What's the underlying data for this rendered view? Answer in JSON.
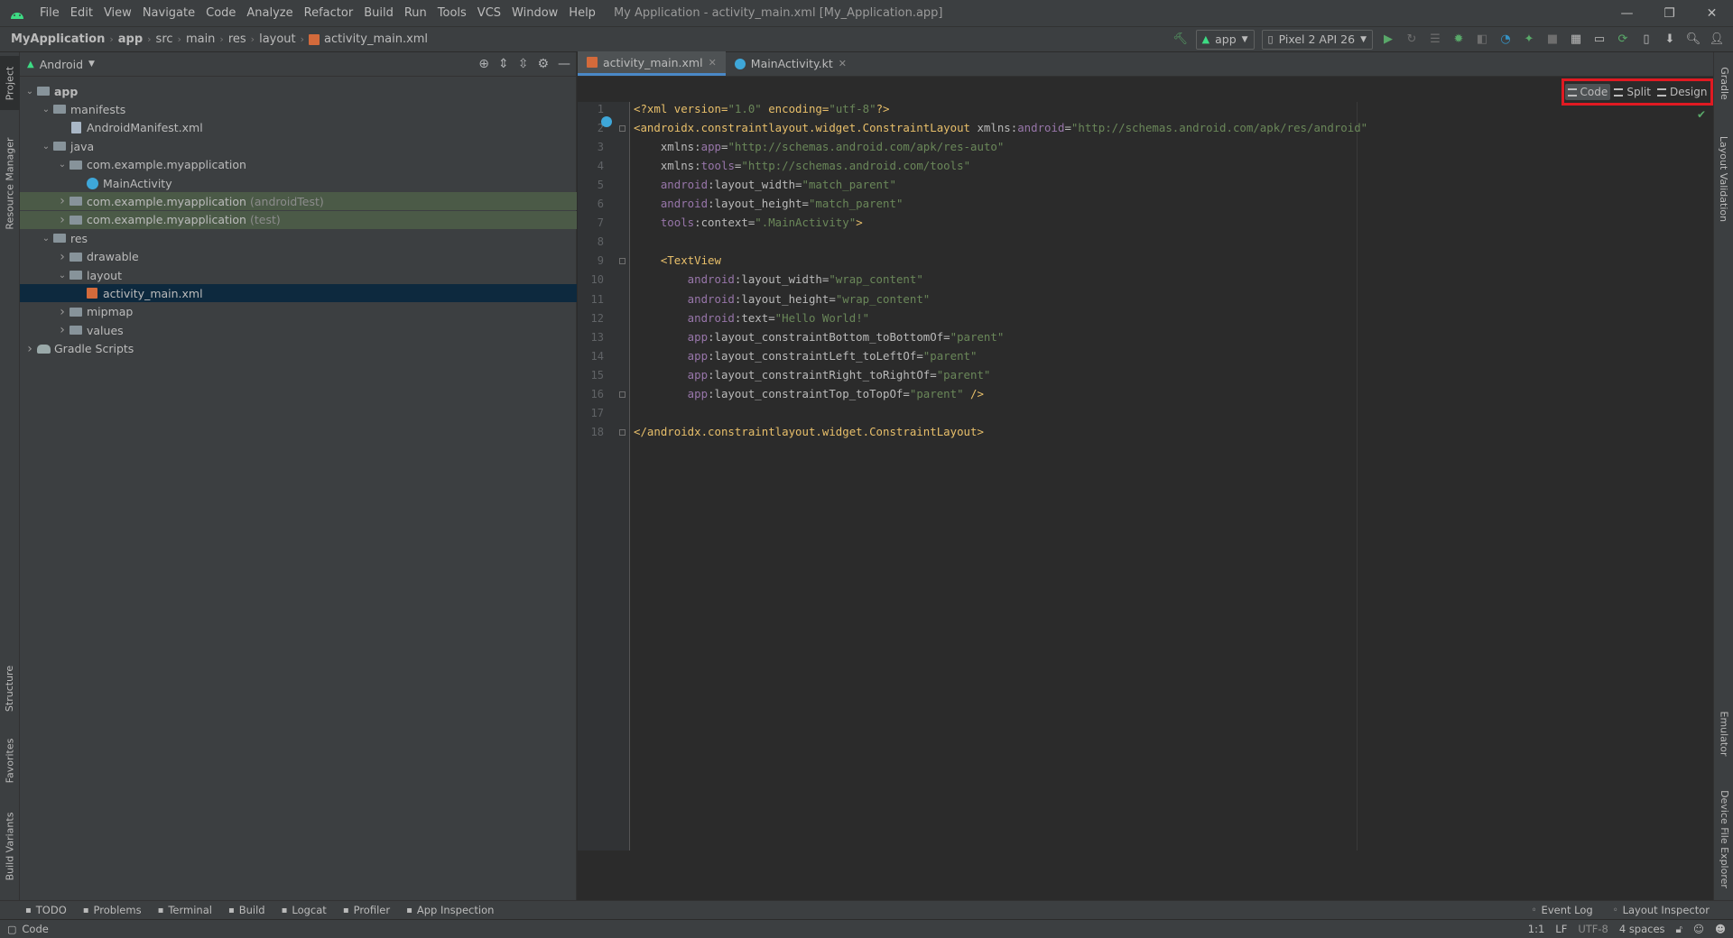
{
  "menu": [
    "File",
    "Edit",
    "View",
    "Navigate",
    "Code",
    "Analyze",
    "Refactor",
    "Build",
    "Run",
    "Tools",
    "VCS",
    "Window",
    "Help"
  ],
  "window_title": "My Application - activity_main.xml [My_Application.app]",
  "breadcrumb": [
    "MyApplication",
    "app",
    "src",
    "main",
    "res",
    "layout",
    "activity_main.xml"
  ],
  "run_config": "app",
  "device": "Pixel 2 API 26",
  "project_panel": {
    "view": "Android"
  },
  "tree": [
    {
      "label": "app",
      "depth": 0,
      "expanded": true,
      "icon": "folder",
      "bold": true
    },
    {
      "label": "manifests",
      "depth": 1,
      "expanded": true,
      "icon": "folder"
    },
    {
      "label": "AndroidManifest.xml",
      "depth": 2,
      "icon": "file"
    },
    {
      "label": "java",
      "depth": 1,
      "expanded": true,
      "icon": "folder"
    },
    {
      "label": "com.example.myapplication",
      "depth": 2,
      "expanded": true,
      "icon": "folder"
    },
    {
      "label": "MainActivity",
      "depth": 3,
      "icon": "kotlin"
    },
    {
      "label": "com.example.myapplication",
      "suffix": "(androidTest)",
      "depth": 2,
      "expanded": false,
      "icon": "folder",
      "state": "highlight"
    },
    {
      "label": "com.example.myapplication",
      "suffix": "(test)",
      "depth": 2,
      "expanded": false,
      "icon": "folder",
      "state": "highlight"
    },
    {
      "label": "res",
      "depth": 1,
      "expanded": true,
      "icon": "folder"
    },
    {
      "label": "drawable",
      "depth": 2,
      "expanded": false,
      "icon": "folder"
    },
    {
      "label": "layout",
      "depth": 2,
      "expanded": true,
      "icon": "folder"
    },
    {
      "label": "activity_main.xml",
      "depth": 3,
      "icon": "xml",
      "state": "selected"
    },
    {
      "label": "mipmap",
      "depth": 2,
      "expanded": false,
      "icon": "folder"
    },
    {
      "label": "values",
      "depth": 2,
      "expanded": false,
      "icon": "folder"
    },
    {
      "label": "Gradle Scripts",
      "depth": 0,
      "expanded": false,
      "icon": "gradle"
    }
  ],
  "editor_tabs": [
    {
      "label": "activity_main.xml",
      "active": true
    },
    {
      "label": "MainActivity.kt",
      "active": false
    }
  ],
  "view_modes": [
    "Code",
    "Split",
    "Design"
  ],
  "active_mode": "Code",
  "code_lines": [
    [
      [
        "pr",
        "<?xml version="
      ],
      [
        "av",
        "\"1.0\""
      ],
      [
        "pr",
        " encoding="
      ],
      [
        "av",
        "\"utf-8\""
      ],
      [
        "pr",
        "?>"
      ]
    ],
    [
      [
        "tag",
        "<androidx.constraintlayout.widget.ConstraintLayout "
      ],
      [
        "an",
        "xmlns:"
      ],
      [
        "ns",
        "android"
      ],
      [
        "an",
        "="
      ],
      [
        "av",
        "\"http://schemas.android.com/apk/res/android\""
      ]
    ],
    [
      [
        "an",
        "    xmlns:"
      ],
      [
        "ns",
        "app"
      ],
      [
        "an",
        "="
      ],
      [
        "av",
        "\"http://schemas.android.com/apk/res-auto\""
      ]
    ],
    [
      [
        "an",
        "    xmlns:"
      ],
      [
        "ns",
        "tools"
      ],
      [
        "an",
        "="
      ],
      [
        "av",
        "\"http://schemas.android.com/tools\""
      ]
    ],
    [
      [
        "ns",
        "    android"
      ],
      [
        "an",
        ":layout_width="
      ],
      [
        "av",
        "\"match_parent\""
      ]
    ],
    [
      [
        "ns",
        "    android"
      ],
      [
        "an",
        ":layout_height="
      ],
      [
        "av",
        "\"match_parent\""
      ]
    ],
    [
      [
        "ns",
        "    tools"
      ],
      [
        "an",
        ":context="
      ],
      [
        "av",
        "\".MainActivity\""
      ],
      [
        "tag",
        ">"
      ]
    ],
    [
      [
        "an",
        ""
      ]
    ],
    [
      [
        "tag",
        "    <TextView"
      ]
    ],
    [
      [
        "ns",
        "        android"
      ],
      [
        "an",
        ":layout_width="
      ],
      [
        "av",
        "\"wrap_content\""
      ]
    ],
    [
      [
        "ns",
        "        android"
      ],
      [
        "an",
        ":layout_height="
      ],
      [
        "av",
        "\"wrap_content\""
      ]
    ],
    [
      [
        "ns",
        "        android"
      ],
      [
        "an",
        ":text="
      ],
      [
        "av",
        "\"Hello World!\""
      ]
    ],
    [
      [
        "ns",
        "        app"
      ],
      [
        "an",
        ":layout_constraintBottom_toBottomOf="
      ],
      [
        "av",
        "\"parent\""
      ]
    ],
    [
      [
        "ns",
        "        app"
      ],
      [
        "an",
        ":layout_constraintLeft_toLeftOf="
      ],
      [
        "av",
        "\"parent\""
      ]
    ],
    [
      [
        "ns",
        "        app"
      ],
      [
        "an",
        ":layout_constraintRight_toRightOf="
      ],
      [
        "av",
        "\"parent\""
      ]
    ],
    [
      [
        "ns",
        "        app"
      ],
      [
        "an",
        ":layout_constraintTop_toTopOf="
      ],
      [
        "av",
        "\"parent\""
      ],
      [
        "tag",
        " />"
      ]
    ],
    [
      [
        "an",
        ""
      ]
    ],
    [
      [
        "tag",
        "</androidx.constraintlayout.widget.ConstraintLayout>"
      ]
    ]
  ],
  "left_tabs": [
    "Project",
    "Resource Manager",
    "Structure",
    "Favorites",
    "Build Variants"
  ],
  "right_tabs": [
    "Gradle",
    "Layout Validation",
    "Emulator",
    "Device File Explorer"
  ],
  "bottom_tools": [
    "TODO",
    "Problems",
    "Terminal",
    "Build",
    "Logcat",
    "Profiler",
    "App Inspection"
  ],
  "bottom_right_tools": [
    "Event Log",
    "Layout Inspector"
  ],
  "status": {
    "left": "Code",
    "position": "1:1",
    "line_sep": "LF",
    "encoding": "UTF-8",
    "indent": "4 spaces"
  }
}
